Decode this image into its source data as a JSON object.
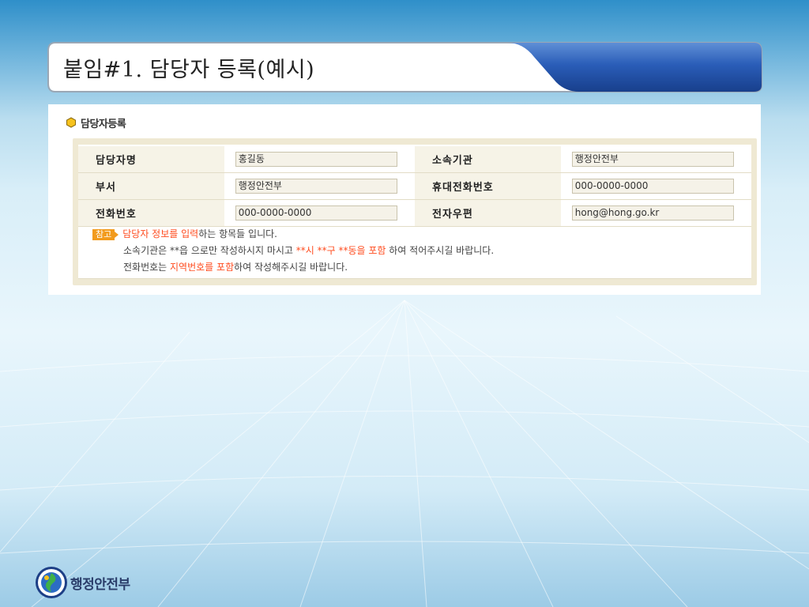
{
  "slide": {
    "title": "붙임#1. 담당자 등록(예시)"
  },
  "section": {
    "title": "담당자등록",
    "icon": "hexagon-bullet-icon"
  },
  "form": {
    "rows": [
      {
        "left_label": "담당자명",
        "left_value": "홍길동",
        "right_label": "소속기관",
        "right_value": "행정안전부"
      },
      {
        "left_label": "부서",
        "left_value": "행정안전부",
        "right_label": "휴대전화번호",
        "right_value": "000-0000-0000"
      },
      {
        "left_label": "전화번호",
        "left_value": "000-0000-0000",
        "right_label": "전자우편",
        "right_value": "hong@hong.go.kr"
      }
    ]
  },
  "notes": {
    "badge": "참고",
    "line1": {
      "hl1": "담당자 정보를 입력",
      "t1": "하는 항목들 입니다."
    },
    "line2": {
      "t1": "소속기관은 **읍 으로만 작성하시지 마시고 ",
      "hl1": "**시 **구 **동을 포함",
      "t2": " 하여 적어주시길 바랍니다."
    },
    "line3": {
      "t1": "전화번호는 ",
      "hl1": "지역번호를 포함",
      "t2": "하여 작성해주시길 바랍니다."
    }
  },
  "footer": {
    "org_name": "행정안전부",
    "emblem_icon": "government-emblem-icon"
  },
  "colors": {
    "highlight": "#ff4c1f",
    "badge": "#f29b1d",
    "frame": "#efe9d3",
    "title_tab": "#1e4fa6"
  }
}
